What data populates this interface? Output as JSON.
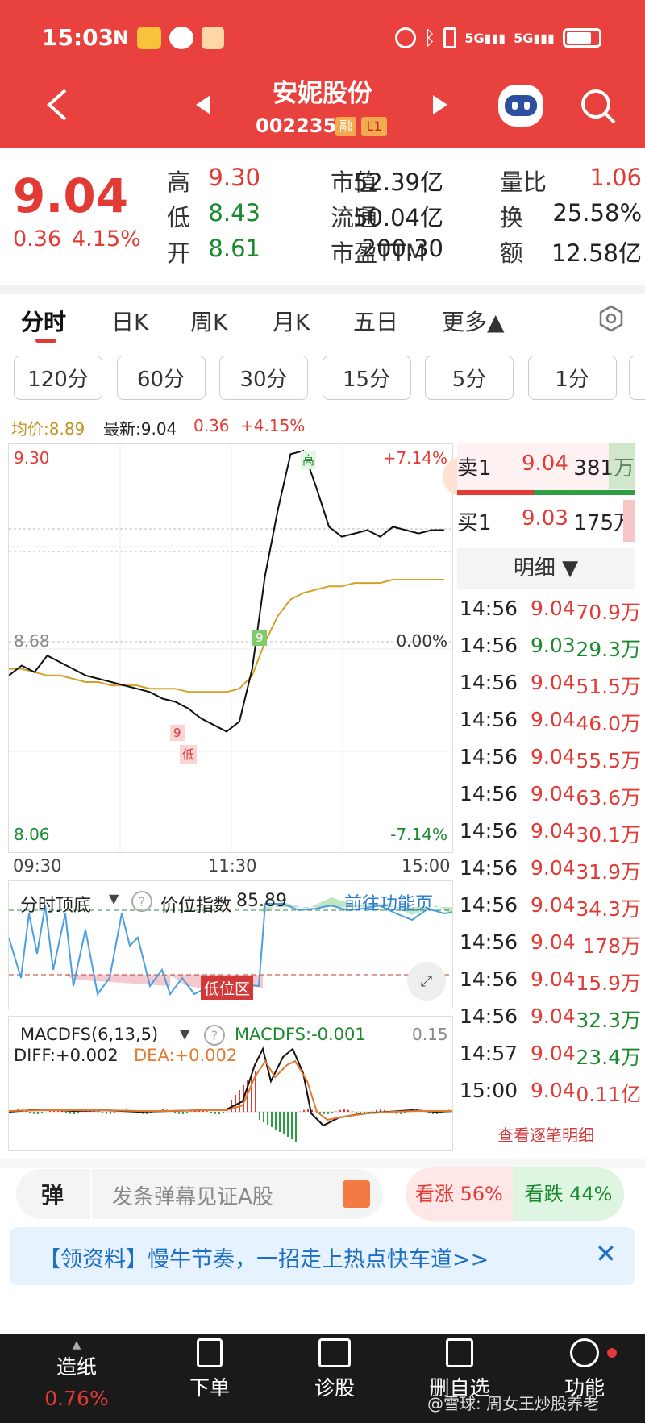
{
  "status_bar": {
    "time": "15:03",
    "icons": [
      "nfc-icon",
      "meituan-icon",
      "wechat-icon",
      "app-icon",
      "alarm-icon",
      "bluetooth-icon",
      "vibrate-icon",
      "signal-5g-icon",
      "signal-5g-icon",
      "battery-icon"
    ]
  },
  "header": {
    "title": "安妮股份",
    "code": "002235",
    "badge_rong": "融",
    "badge_level": "L1"
  },
  "quote": {
    "price": "9.04",
    "change": "0.36",
    "change_pct": "4.15%",
    "rows": [
      [
        {
          "l": "高",
          "v": "9.30",
          "c": "red"
        },
        {
          "l": "市值",
          "v": "52.39亿"
        },
        {
          "l": "量比",
          "v": "1.06",
          "c": "red"
        }
      ],
      [
        {
          "l": "低",
          "v": "8.43",
          "c": "green"
        },
        {
          "l": "流通",
          "v": "50.04亿"
        },
        {
          "l": "换",
          "v": "25.58%"
        }
      ],
      [
        {
          "l": "开",
          "v": "8.61",
          "c": "green"
        },
        {
          "l": "市盈TTM",
          "v": "200.30"
        },
        {
          "l": "额",
          "v": "12.58亿"
        }
      ]
    ]
  },
  "tabs": [
    "分时",
    "日K",
    "周K",
    "月K",
    "五日",
    "更多▲"
  ],
  "periods": [
    "120分",
    "60分",
    "30分",
    "15分",
    "5分",
    "1分"
  ],
  "ticker": {
    "avg": "均价:8.89",
    "latest": "最新:9.04",
    "chg": "0.36",
    "pct": "+4.15%"
  },
  "chart": {
    "y_top": "9.30",
    "y_mid": "8.68",
    "y_bot": "8.06",
    "pct_top": "+7.14%",
    "pct_mid": "0.00%",
    "pct_bot": "-7.14%",
    "x_labels": [
      "09:30",
      "11:30",
      "15:00"
    ],
    "high_tag": "高",
    "low_tag": "低",
    "nine_tag": "9"
  },
  "chart_data": {
    "type": "line",
    "ylim": [
      8.06,
      9.3
    ],
    "series": [
      {
        "values": [
          8.6,
          8.63,
          8.61,
          8.66,
          8.64,
          8.62,
          8.6,
          8.59,
          8.58,
          8.57,
          8.56,
          8.55,
          8.53,
          8.52,
          8.5,
          8.47,
          8.45,
          8.43,
          8.46,
          8.62,
          8.9,
          9.1,
          9.27,
          9.28,
          9.17,
          9.05,
          9.02,
          9.03,
          9.04,
          9.02,
          9.05,
          9.04,
          9.03,
          9.04,
          9.04
        ]
      },
      {
        "values": [
          8.62,
          8.62,
          8.61,
          8.6,
          8.6,
          8.59,
          8.58,
          8.58,
          8.57,
          8.57,
          8.57,
          8.56,
          8.56,
          8.56,
          8.55,
          8.55,
          8.55,
          8.55,
          8.56,
          8.6,
          8.7,
          8.78,
          8.83,
          8.85,
          8.86,
          8.87,
          8.87,
          8.88,
          8.88,
          8.88,
          8.89,
          8.89,
          8.89,
          8.89,
          8.89
        ]
      }
    ]
  },
  "indicator": {
    "name": "分时顶底",
    "label": "价位指数",
    "value": "85.89",
    "link": "前往功能页",
    "low_zone": "低位区"
  },
  "macd": {
    "name": "MACDFS(6,13,5)",
    "macdfs": "MACDFS:-0.001",
    "diff": "DIFF:+0.002",
    "dea": "DEA:+0.002",
    "scale": "0.15"
  },
  "book": {
    "sell_label": "卖1",
    "sell_price": "9.04",
    "sell_vol": "381万",
    "buy_label": "买1",
    "buy_price": "9.03",
    "buy_vol": "175万",
    "detail_title": "明细 ▼"
  },
  "trades": [
    {
      "t": "14:56",
      "p": "9.04",
      "v": "70.9万",
      "c": "red"
    },
    {
      "t": "14:56",
      "p": "9.03",
      "v": "29.3万",
      "c": "green"
    },
    {
      "t": "14:56",
      "p": "9.04",
      "v": "51.5万",
      "c": "red"
    },
    {
      "t": "14:56",
      "p": "9.04",
      "v": "46.0万",
      "c": "red"
    },
    {
      "t": "14:56",
      "p": "9.04",
      "v": "55.5万",
      "c": "red"
    },
    {
      "t": "14:56",
      "p": "9.04",
      "v": "63.6万",
      "c": "red"
    },
    {
      "t": "14:56",
      "p": "9.04",
      "v": "30.1万",
      "c": "red"
    },
    {
      "t": "14:56",
      "p": "9.04",
      "v": "31.9万",
      "c": "red"
    },
    {
      "t": "14:56",
      "p": "9.04",
      "v": "34.3万",
      "c": "red"
    },
    {
      "t": "14:56",
      "p": "9.04",
      "v": "178万",
      "c": "red"
    },
    {
      "t": "14:56",
      "p": "9.04",
      "v": "15.9万",
      "c": "red"
    },
    {
      "t": "14:56",
      "p": "9.04",
      "v": "32.3万",
      "c": "green"
    },
    {
      "t": "14:57",
      "p": "9.04",
      "v": "23.4万",
      "c": "green"
    },
    {
      "t": "15:00",
      "p": "9.04",
      "v": "0.11亿",
      "c": "red"
    }
  ],
  "view_detail": "查看逐笔明细",
  "danmu": {
    "btn": "弹",
    "placeholder": "发条弹幕见证A股",
    "up": "看涨 56%",
    "down": "看跌 44%"
  },
  "banner": {
    "text": "【领资料】慢牛节奏，一招走上热点快车道>>"
  },
  "nav": {
    "items": [
      {
        "label": "造纸",
        "sub": "0.76%"
      },
      {
        "label": "下单"
      },
      {
        "label": "诊股"
      },
      {
        "label": "删自选"
      },
      {
        "label": "功能"
      }
    ],
    "watermark": "@雪球: 周女王炒股养老"
  }
}
